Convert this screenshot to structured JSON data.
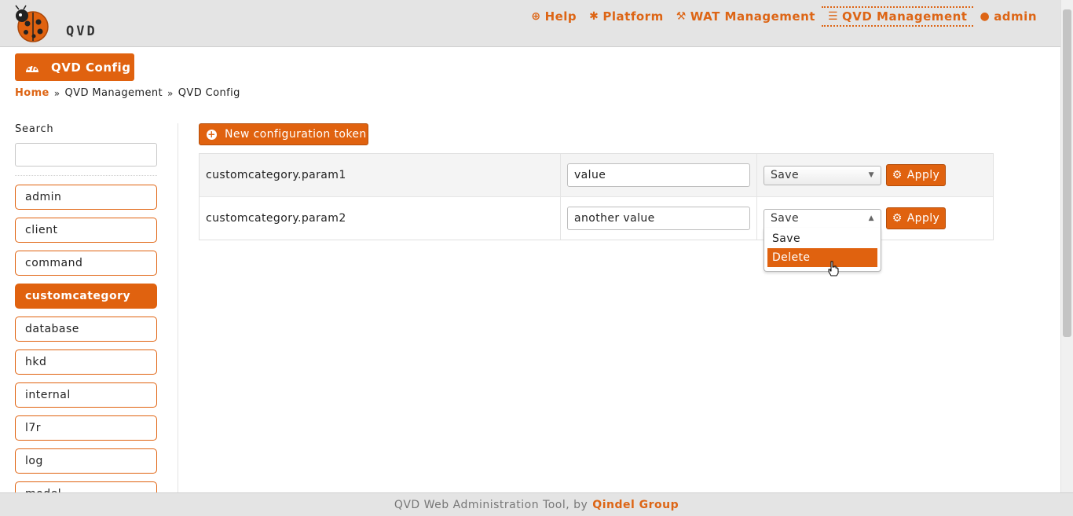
{
  "header": {
    "logo_text": "QVD",
    "nav": [
      {
        "icon": "lifebuoy-icon",
        "label": "Help"
      },
      {
        "icon": "bug-icon",
        "label": "Platform"
      },
      {
        "icon": "wrench-icon",
        "label": "WAT Management"
      },
      {
        "icon": "sliders-icon",
        "label": "QVD Management"
      },
      {
        "icon": "user-icon",
        "label": "admin"
      }
    ]
  },
  "page": {
    "title": "QVD Config",
    "breadcrumb": [
      "Home",
      "QVD Management",
      "QVD Config"
    ]
  },
  "sidebar": {
    "search_label": "Search",
    "search_value": "",
    "categories": [
      "admin",
      "client",
      "command",
      "customcategory",
      "database",
      "hkd",
      "internal",
      "l7r",
      "log",
      "model"
    ],
    "selected": "customcategory"
  },
  "main": {
    "new_button_label": "New configuration token",
    "rows": [
      {
        "key": "customcategory.param1",
        "value": "value",
        "action": "Save",
        "apply_label": "Apply"
      },
      {
        "key": "customcategory.param2",
        "value": "another value",
        "action": "Save",
        "apply_label": "Apply"
      }
    ],
    "dropdown_options": [
      "Save",
      "Delete"
    ],
    "dropdown_highlighted": "Delete"
  },
  "footer": {
    "text": "QVD Web Administration Tool, by",
    "brand": "Qindel Group"
  },
  "colors": {
    "accent": "#e0620f",
    "header_bg": "#e4e4e4"
  }
}
